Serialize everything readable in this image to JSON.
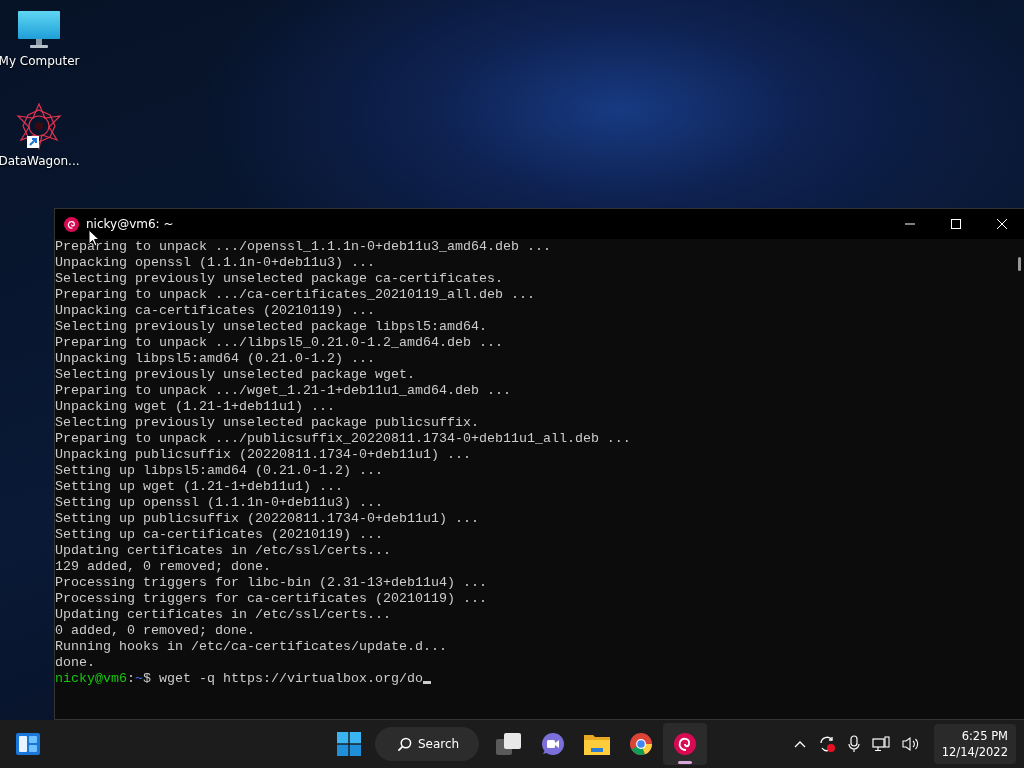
{
  "desktop_icons": [
    {
      "label": "My Computer",
      "kind": "computer"
    },
    {
      "label": "DataWagon...",
      "kind": "shortcut"
    }
  ],
  "terminal": {
    "title": "nicky@vm6: ~",
    "lines": [
      "Preparing to unpack .../openssl_1.1.1n-0+deb11u3_amd64.deb ...",
      "Unpacking openssl (1.1.1n-0+deb11u3) ...",
      "Selecting previously unselected package ca-certificates.",
      "Preparing to unpack .../ca-certificates_20210119_all.deb ...",
      "Unpacking ca-certificates (20210119) ...",
      "Selecting previously unselected package libpsl5:amd64.",
      "Preparing to unpack .../libpsl5_0.21.0-1.2_amd64.deb ...",
      "Unpacking libpsl5:amd64 (0.21.0-1.2) ...",
      "Selecting previously unselected package wget.",
      "Preparing to unpack .../wget_1.21-1+deb11u1_amd64.deb ...",
      "Unpacking wget (1.21-1+deb11u1) ...",
      "Selecting previously unselected package publicsuffix.",
      "Preparing to unpack .../publicsuffix_20220811.1734-0+deb11u1_all.deb ...",
      "Unpacking publicsuffix (20220811.1734-0+deb11u1) ...",
      "Setting up libpsl5:amd64 (0.21.0-1.2) ...",
      "Setting up wget (1.21-1+deb11u1) ...",
      "Setting up openssl (1.1.1n-0+deb11u3) ...",
      "Setting up publicsuffix (20220811.1734-0+deb11u1) ...",
      "Setting up ca-certificates (20210119) ...",
      "Updating certificates in /etc/ssl/certs...",
      "129 added, 0 removed; done.",
      "Processing triggers for libc-bin (2.31-13+deb11u4) ...",
      "Processing triggers for ca-certificates (20210119) ...",
      "Updating certificates in /etc/ssl/certs...",
      "0 added, 0 removed; done.",
      "Running hooks in /etc/ca-certificates/update.d...",
      "done."
    ],
    "prompt": {
      "user": "nicky@vm6",
      "separator": ":",
      "path": "~",
      "symbol": "$",
      "command": "wget -q https://virtualbox.org/do"
    }
  },
  "taskbar": {
    "search": {
      "label": "Search"
    },
    "apps": [
      {
        "kind": "taskview",
        "active": false
      },
      {
        "kind": "chat",
        "active": false
      },
      {
        "kind": "explorer",
        "active": false
      },
      {
        "kind": "browser",
        "active": false
      },
      {
        "kind": "debian",
        "active": true
      }
    ],
    "clock": {
      "time": "6:25 PM",
      "date": "12/14/2022"
    }
  }
}
